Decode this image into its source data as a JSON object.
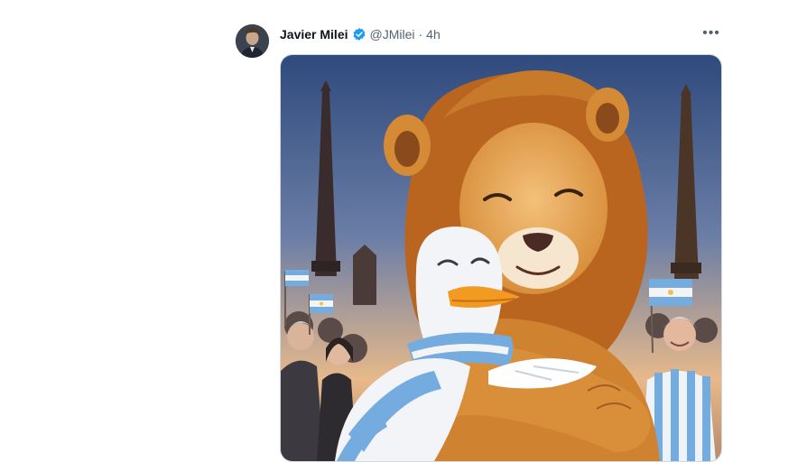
{
  "tweet": {
    "author_name": "Javier Milei",
    "handle": "@JMilei",
    "separator": "·",
    "time": "4h",
    "more_glyph": "•••",
    "verified_color": "#1d9bf0"
  },
  "media": {
    "icon": "illustration-lion-hugging-duck",
    "colors": {
      "sky_top": "#2f4a7d",
      "sky_bottom": "#e7b98a",
      "lion": "#d58a35",
      "mane": "#b9651f",
      "flag_blue": "#74acdf",
      "duck": "#f2f4f8",
      "beak": "#f29a21"
    }
  }
}
